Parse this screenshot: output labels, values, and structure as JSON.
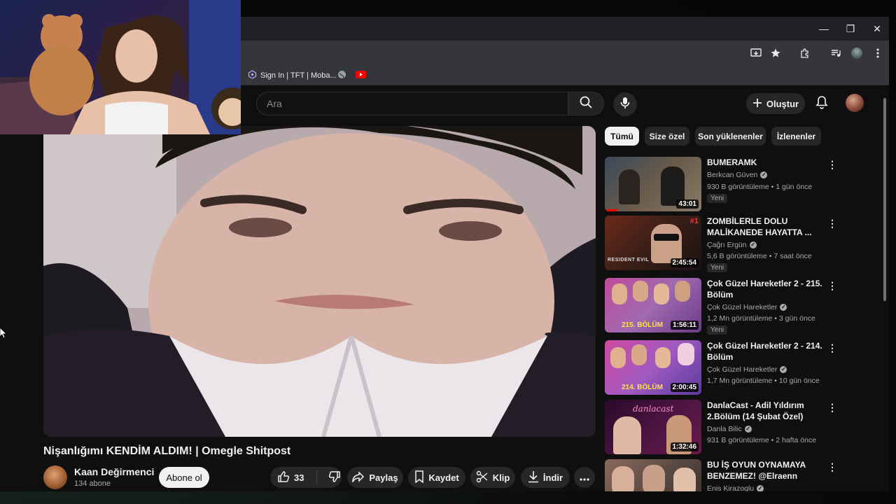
{
  "browser": {
    "window_controls": {
      "minimize": "—",
      "restore": "❐",
      "close": "✕"
    },
    "bookmarks": [
      {
        "label": "Sign In | TFT | Moba...",
        "icon": "tft-icon"
      },
      {
        "label": "",
        "icon": "globe-icon"
      },
      {
        "label": "",
        "icon": "youtube-icon"
      }
    ]
  },
  "header": {
    "search_placeholder": "Ara",
    "create_label": "Oluştur"
  },
  "video": {
    "title": "Nişanlığımı KENDİM ALDIM! | Omegle Shitpost",
    "channel": "Kaan Değirmenci",
    "subscribers": "134 abone",
    "subscribe_label": "Abone ol",
    "likes": "33",
    "share_label": "Paylaş",
    "save_label": "Kaydet",
    "clip_label": "Klip",
    "download_label": "İndir"
  },
  "chips": [
    {
      "label": "Tümü",
      "active": true
    },
    {
      "label": "Size özel",
      "active": false
    },
    {
      "label": "Son yüklenenler",
      "active": false
    },
    {
      "label": "İzlenenler",
      "active": false
    }
  ],
  "recommendations": [
    {
      "title": "BUMERAMK",
      "channel": "Berkcan Güven",
      "views": "930 B görüntüleme",
      "age": "1 gün önce",
      "badge": "Yeni",
      "duration": "43:01",
      "watched_fraction": 0.12,
      "thumb_colors": [
        "#3a4a5a",
        "#8a7a6a"
      ]
    },
    {
      "title": "ZOMBİLERLE DOLU MALİKANEDE HAYATTA ...",
      "channel": "Çağrı Ergün",
      "views": "5,6 B görüntüleme",
      "age": "7 saat önce",
      "badge": "Yeni",
      "duration": "2:45:54",
      "rank": "#1",
      "thumb_colors": [
        "#5a2a1a",
        "#2a1a14"
      ]
    },
    {
      "title": "Çok Güzel Hareketler 2 - 215. Bölüm",
      "channel": "Çok Güzel Hareketler",
      "views": "1,2 Mn görüntüleme",
      "age": "3 gün önce",
      "badge": "Yeni",
      "duration": "1:56:11",
      "overlay": "215. BÖLÜM",
      "thumb_colors": [
        "#c04a9a",
        "#6a3a8a"
      ]
    },
    {
      "title": "Çok Güzel Hareketler 2 - 214. Bölüm",
      "channel": "Çok Güzel Hareketler",
      "views": "1,7 Mn görüntüleme",
      "age": "10 gün önce",
      "duration": "2:00:45",
      "overlay": "214. BÖLÜM",
      "thumb_colors": [
        "#d04aa0",
        "#5a3aa0"
      ]
    },
    {
      "title": "DanlaCast - Adil Yıldırım 2.Bölüm (14 Şubat Özel)",
      "channel": "Danla Bilic",
      "views": "931 B görüntüleme",
      "age": "2 hafta önce",
      "duration": "1:32:46",
      "overlay": "danlacast",
      "thumb_colors": [
        "#2a0a2a",
        "#6a1a4a"
      ]
    },
    {
      "title": "BU İŞ OYUN OYNAMAYA BENZEMEZ! @Elraenn YEMEK ...",
      "channel": "Enis Kirazoglu",
      "views": "",
      "age": "",
      "duration": "",
      "thumb_colors": [
        "#8a6a5a",
        "#3a2a2a"
      ]
    }
  ],
  "colors": {
    "accent_red": "#ff0000",
    "page_bg": "#0f0f0f",
    "chip_bg": "#272727"
  }
}
